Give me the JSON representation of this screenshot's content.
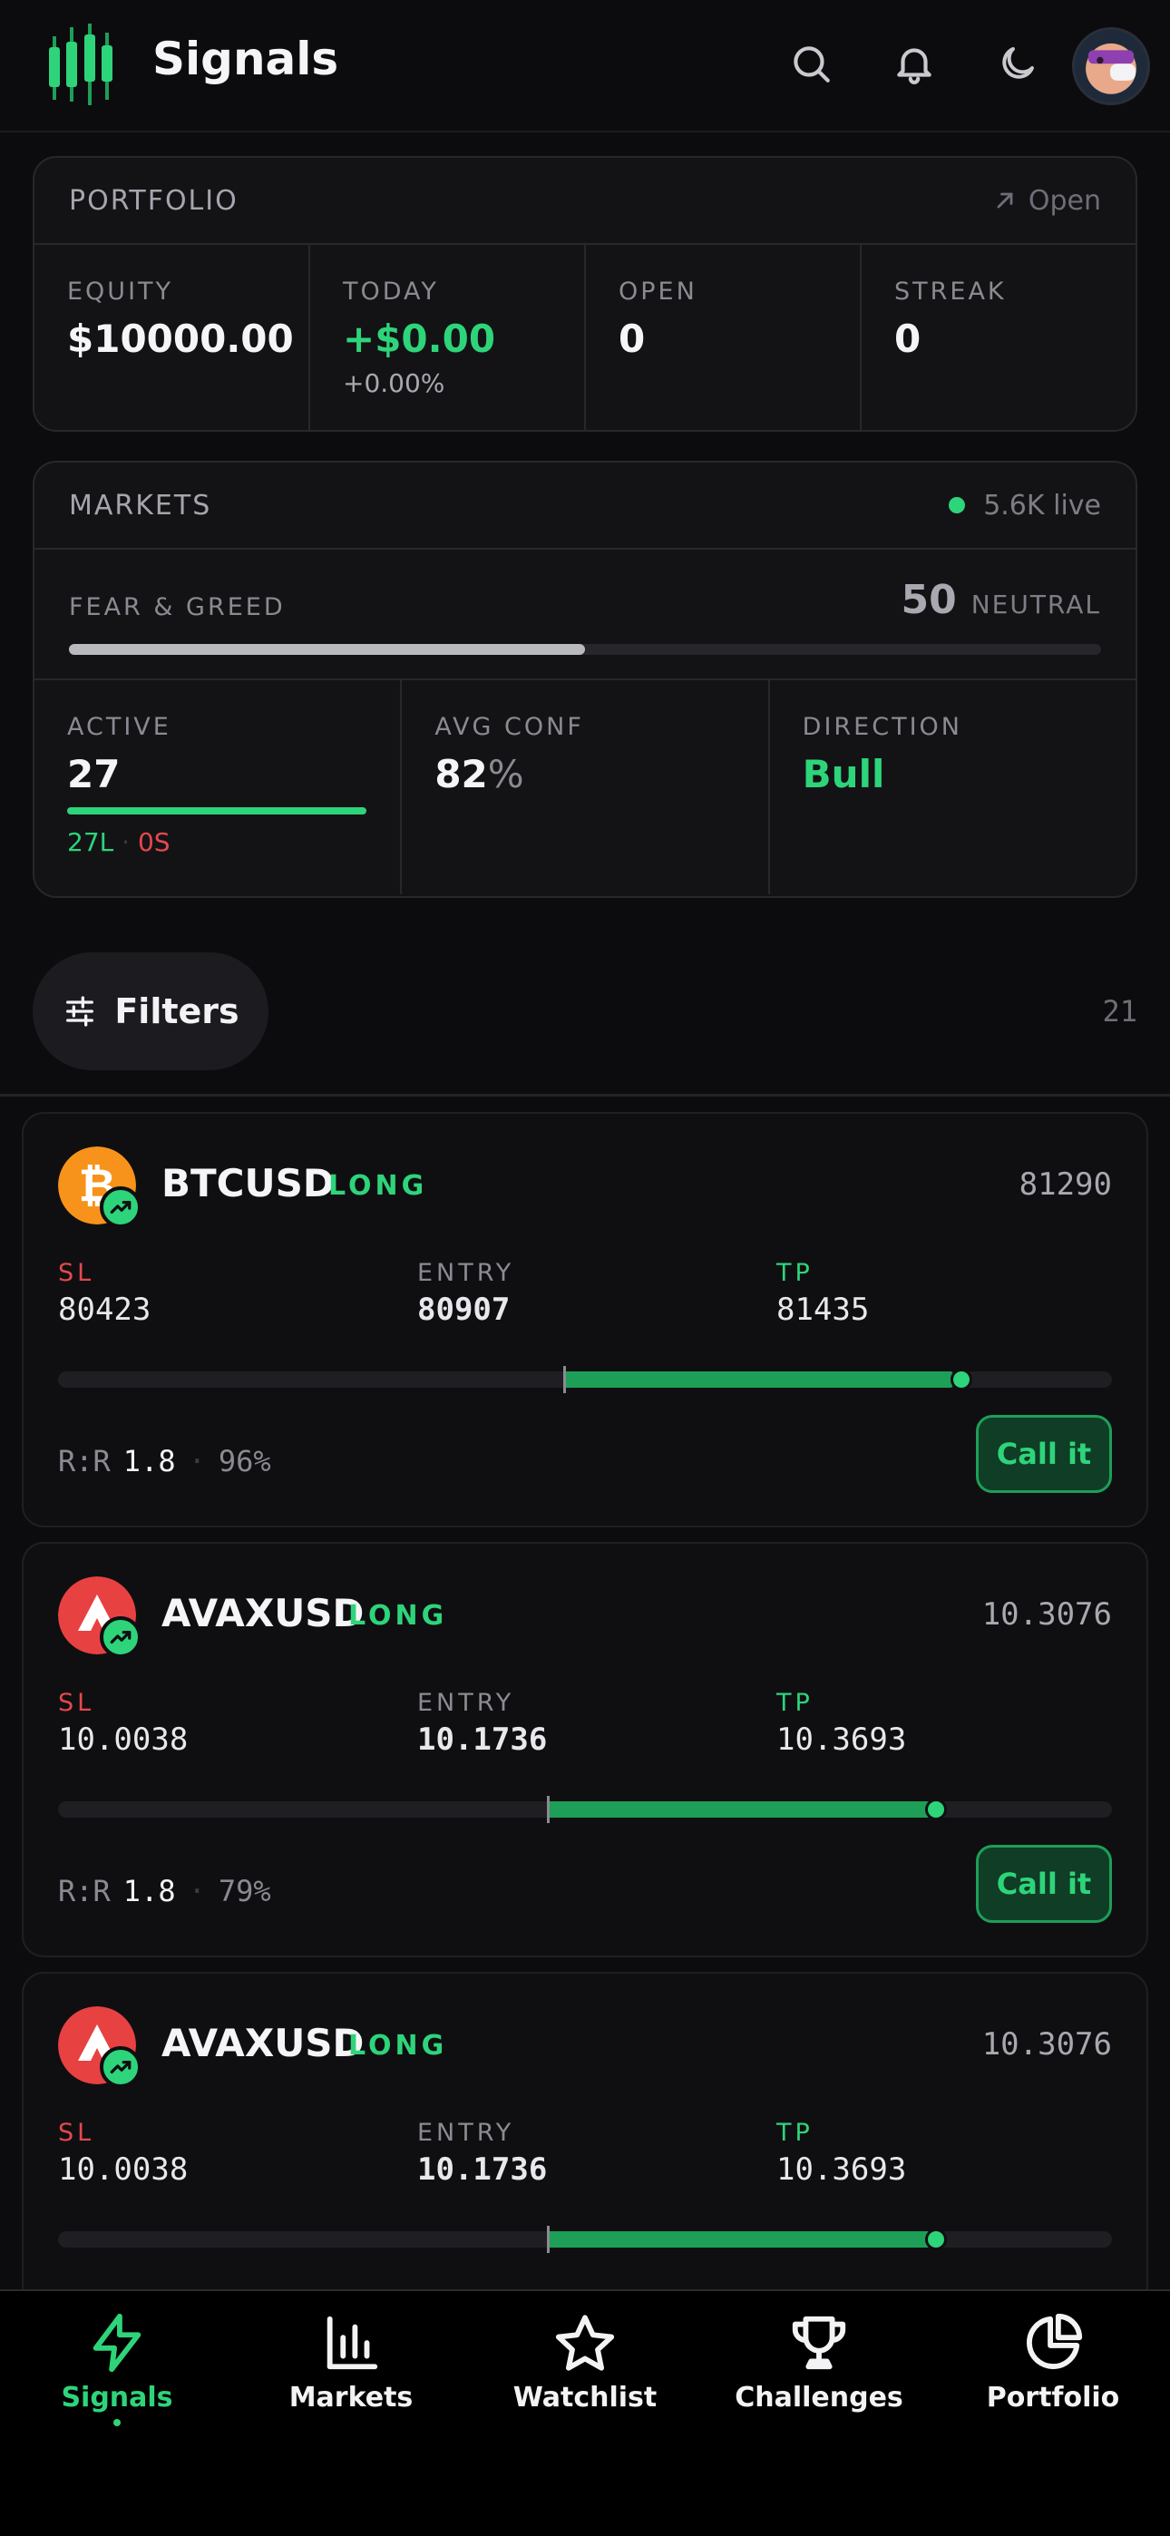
{
  "header": {
    "title": "Signals",
    "icons": [
      "search-icon",
      "bell-icon",
      "moon-icon",
      "avatar"
    ]
  },
  "portfolio": {
    "title": "PORTFOLIO",
    "open_link": "Open",
    "stats": [
      {
        "label": "EQUITY",
        "value": "$10000.00",
        "sub": ""
      },
      {
        "label": "TODAY",
        "value": "+$0.00",
        "sub": "+0.00%"
      },
      {
        "label": "OPEN",
        "value": "0",
        "sub": ""
      },
      {
        "label": "STREAK",
        "value": "0",
        "sub": ""
      }
    ]
  },
  "markets": {
    "title": "MARKETS",
    "live": "5.6K live",
    "fear_greed": {
      "label": "FEAR & GREED",
      "value": "50",
      "word": "NEUTRAL",
      "fraction": 0.5
    },
    "active": {
      "label": "ACTIVE",
      "value": "27",
      "long": "27L",
      "dot": "·",
      "short": "0S",
      "long_fraction": 1.0
    },
    "avg_conf": {
      "label": "AVG CONF",
      "value": "82",
      "unit": "%"
    },
    "direction": {
      "label": "DIRECTION",
      "value": "Bull"
    }
  },
  "filters": {
    "label": "Filters",
    "count": "21"
  },
  "signals": [
    {
      "symbol": "BTCUSD",
      "direction": "LONG",
      "price": "81290",
      "coin": "bitcoin",
      "sl_label": "SL",
      "entry_label": "ENTRY",
      "tp_label": "TP",
      "sl": "80423",
      "entry": "80907",
      "tp": "81435",
      "rr_label": "R:R",
      "rr": "1.8",
      "conf": "96%",
      "cta": "Call it"
    },
    {
      "symbol": "AVAXUSD",
      "direction": "LONG",
      "price": "10.3076",
      "coin": "avalanche",
      "sl_label": "SL",
      "entry_label": "ENTRY",
      "tp_label": "TP",
      "sl": "10.0038",
      "entry": "10.1736",
      "tp": "10.3693",
      "rr_label": "R:R",
      "rr": "1.8",
      "conf": "79%",
      "cta": "Call it"
    },
    {
      "symbol": "AVAXUSD",
      "direction": "LONG",
      "price": "10.3076",
      "coin": "avalanche",
      "sl_label": "SL",
      "entry_label": "ENTRY",
      "tp_label": "TP",
      "sl": "10.0038",
      "entry": "10.1736",
      "tp": "10.3693"
    }
  ],
  "nav": [
    {
      "label": "Signals",
      "icon": "bolt-icon",
      "active": true
    },
    {
      "label": "Markets",
      "icon": "bar-chart-icon",
      "active": false
    },
    {
      "label": "Watchlist",
      "icon": "star-icon",
      "active": false
    },
    {
      "label": "Challenges",
      "icon": "trophy-icon",
      "active": false
    },
    {
      "label": "Portfolio",
      "icon": "pie-chart-icon",
      "active": false
    }
  ],
  "colors": {
    "accent": "#2ed47a",
    "danger": "#e5484d",
    "background": "#0c0c0e"
  }
}
